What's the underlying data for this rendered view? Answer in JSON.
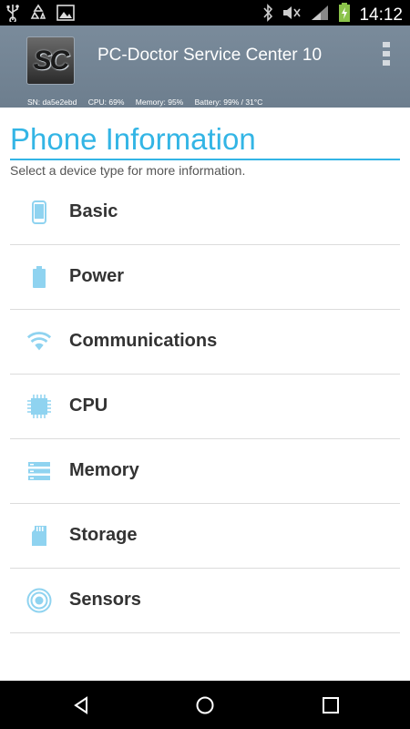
{
  "status_bar": {
    "time": "14:12",
    "left_icons": [
      "usb-icon",
      "recycle-icon",
      "image-icon"
    ],
    "right_icons": [
      "bluetooth-icon",
      "muted-icon",
      "signal-icon",
      "battery-charging-icon"
    ]
  },
  "header": {
    "app_title": "PC-Doctor Service Center 10",
    "logo_text": "SC",
    "stats": {
      "sn": "SN: da5e2ebd",
      "cpu": "CPU: 69%",
      "memory": "Memory: 95%",
      "battery": "Battery: 99% / 31°C"
    }
  },
  "main": {
    "title": "Phone Information",
    "subtitle": "Select a device type for more information.",
    "items": [
      {
        "label": "Basic",
        "icon": "phone-icon"
      },
      {
        "label": "Power",
        "icon": "battery-icon"
      },
      {
        "label": "Communications",
        "icon": "wifi-icon"
      },
      {
        "label": "CPU",
        "icon": "chip-icon"
      },
      {
        "label": "Memory",
        "icon": "memory-icon"
      },
      {
        "label": "Storage",
        "icon": "sd-card-icon"
      },
      {
        "label": "Sensors",
        "icon": "sensor-icon"
      }
    ]
  },
  "colors": {
    "accent": "#33b5e5",
    "icon": "#8fd3f0",
    "header": "#75879a"
  },
  "nav_bar": {
    "buttons": [
      "back-icon",
      "home-icon",
      "recents-icon"
    ]
  }
}
